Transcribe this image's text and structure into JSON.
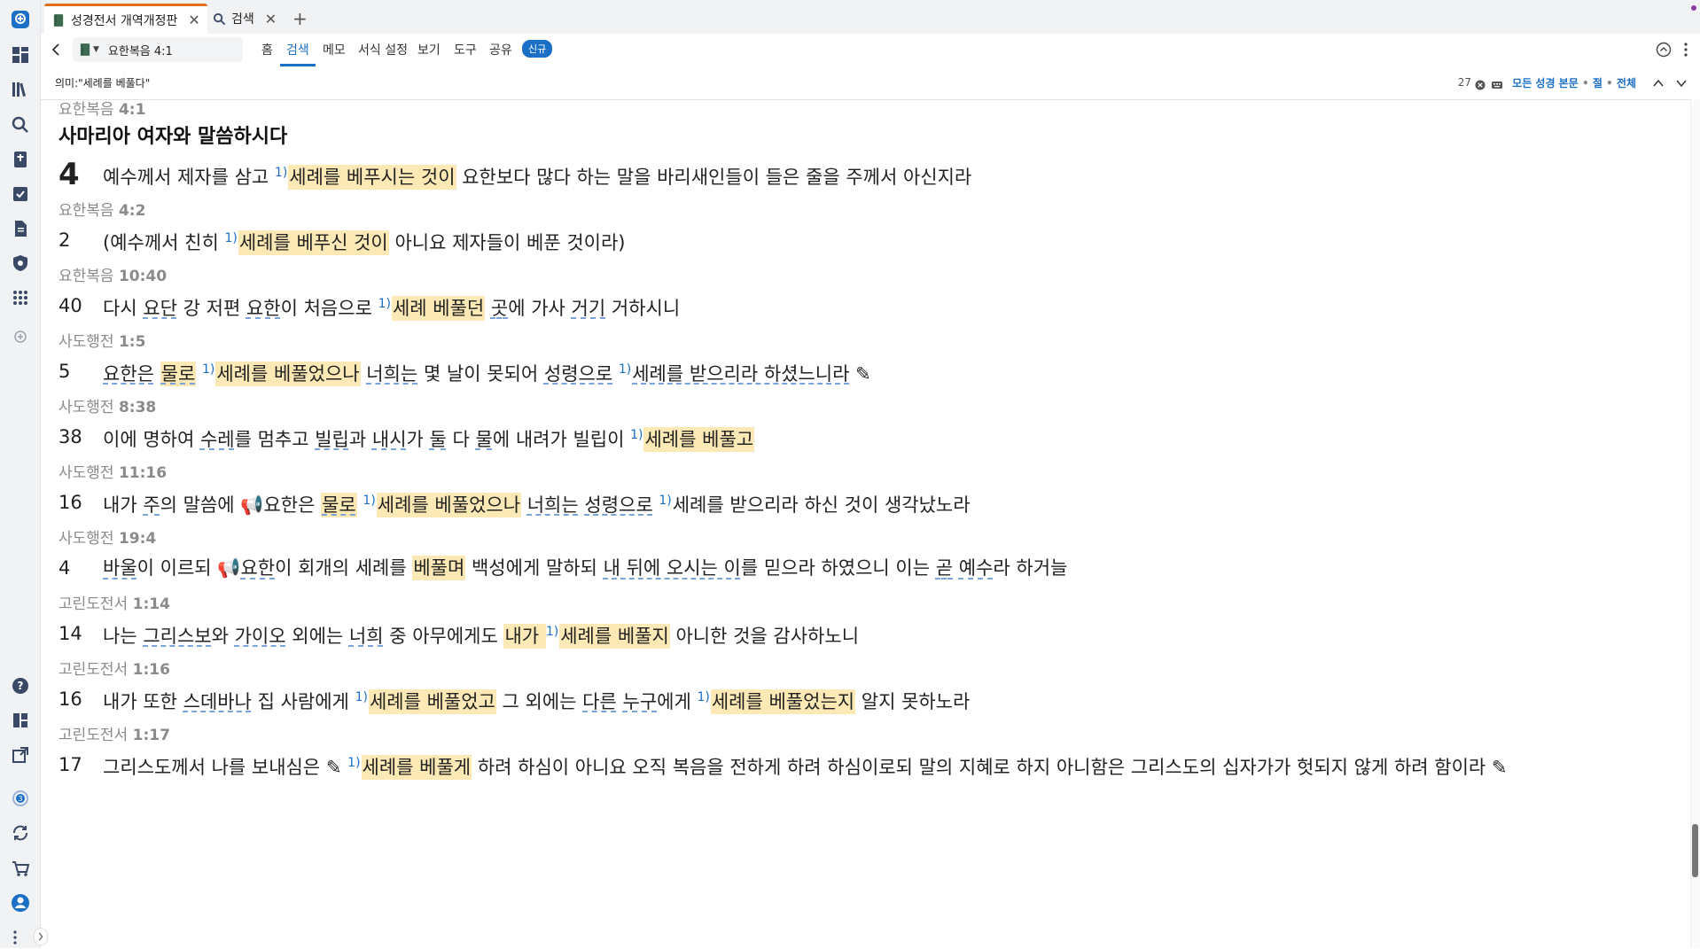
{
  "tabs": [
    {
      "label": "성경전서 개역개정판",
      "active": true
    },
    {
      "label": "검색",
      "active": false
    }
  ],
  "toolbar": {
    "reference": "요한복음 4:1",
    "menu": [
      "홈",
      "검색",
      "메모",
      "서식 설정",
      "보기",
      "도구",
      "공유"
    ],
    "active_menu": "검색",
    "new_badge": "신규"
  },
  "search": {
    "query": "의미:\"세례를 베풀다\"",
    "count": "27",
    "scope_label": "모든 성경 본문",
    "scope_sep": "•",
    "scope_unit": "절",
    "scope_all": "전체"
  },
  "colors": {
    "accent": "#1b6fc7",
    "highlight": "#fde9b5",
    "tab_active": "#e06f1f"
  },
  "results": [
    {
      "book": "요한복음",
      "ch": "4:1",
      "heading": "사마리아 여자와 말씀하시다",
      "num": "4",
      "big": true,
      "parts": [
        {
          "t": "예수께서 제자를 삼고 "
        },
        {
          "fn": "1)"
        },
        {
          "t": "세례를 베푸시는 것이",
          "h": true
        },
        {
          "t": " 요한보다 많다 하는 말을 바리새인들이 들은 줄을 주께서 아신지라"
        }
      ]
    },
    {
      "book": "요한복음",
      "ch": "4:2",
      "num": "2",
      "parts": [
        {
          "t": "(예수께서 친히 "
        },
        {
          "fn": "1)"
        },
        {
          "t": "세례를 베푸신 것이",
          "h": true
        },
        {
          "t": " 아니요 제자들이 베푼 것이라)"
        }
      ]
    },
    {
      "book": "요한복음",
      "ch": "10:40",
      "num": "40",
      "parts": [
        {
          "t": "다시 "
        },
        {
          "t": "요단",
          "u": true
        },
        {
          "t": " 강 저편 "
        },
        {
          "t": "요한",
          "u": true
        },
        {
          "t": "이 처음으로 "
        },
        {
          "fn": "1)"
        },
        {
          "t": "세례 베풀던",
          "h": true
        },
        {
          "t": " "
        },
        {
          "t": "곳",
          "u": true
        },
        {
          "t": "에 가사 "
        },
        {
          "t": "거기",
          "u": true
        },
        {
          "t": " 거하시니"
        }
      ]
    },
    {
      "book": "사도행전",
      "ch": "1:5",
      "num": "5",
      "parts": [
        {
          "t": "요한은",
          "u": true
        },
        {
          "t": " "
        },
        {
          "t": "물로",
          "h": true,
          "u": true
        },
        {
          "t": " "
        },
        {
          "fn": "1)"
        },
        {
          "t": "세례를 베풀었으나",
          "h": true
        },
        {
          "t": " "
        },
        {
          "t": "너희는",
          "u": true
        },
        {
          "t": " 몇 날이 못되어 "
        },
        {
          "t": "성령으로",
          "u": true
        },
        {
          "t": " "
        },
        {
          "fn": "1)"
        },
        {
          "t": "세례를 받으리라 하셨느니라",
          "u": true
        },
        {
          "t": " ✎"
        }
      ]
    },
    {
      "book": "사도행전",
      "ch": "8:38",
      "num": "38",
      "parts": [
        {
          "t": "이에 명하여 "
        },
        {
          "t": "수레",
          "u": true
        },
        {
          "t": "를 멈추고 "
        },
        {
          "t": "빌립",
          "u": true
        },
        {
          "t": "과 "
        },
        {
          "t": "내시",
          "u": true
        },
        {
          "t": "가 "
        },
        {
          "t": "둘",
          "u": true
        },
        {
          "t": " 다 "
        },
        {
          "t": "물",
          "u": true
        },
        {
          "t": "에 내려가 빌립이 "
        },
        {
          "fn": "1)"
        },
        {
          "t": "세례를 베풀고",
          "h": true
        }
      ]
    },
    {
      "book": "사도행전",
      "ch": "11:16",
      "num": "16",
      "parts": [
        {
          "t": "내가 "
        },
        {
          "t": "주",
          "u": true
        },
        {
          "t": "의 말씀에 "
        },
        {
          "t": "📢"
        },
        {
          "t": "요한은 "
        },
        {
          "t": "물로",
          "h": true,
          "u": true
        },
        {
          "t": " "
        },
        {
          "fn": "1)"
        },
        {
          "t": "세례를 베풀었으나",
          "h": true
        },
        {
          "t": " "
        },
        {
          "t": "너희는",
          "u": true
        },
        {
          "t": " "
        },
        {
          "t": "성령으로",
          "u": true
        },
        {
          "t": " "
        },
        {
          "fn": "1)"
        },
        {
          "t": "세례를 받으리라 하신 것이 생각났노라"
        }
      ]
    },
    {
      "book": "사도행전",
      "ch": "19:4",
      "num": "4",
      "parts": [
        {
          "t": "바울",
          "u": true
        },
        {
          "t": "이 이르되 "
        },
        {
          "t": "📢"
        },
        {
          "t": "요한",
          "u": true
        },
        {
          "t": "이 회개의 세례를 "
        },
        {
          "t": "베풀며",
          "h": true
        },
        {
          "t": " 백성에게 말하되 "
        },
        {
          "t": "내 뒤에 오시는 이",
          "u": true
        },
        {
          "t": "를 믿으라 하였으니 이는 "
        },
        {
          "t": "곧",
          "u": true
        },
        {
          "t": " "
        },
        {
          "t": "예수",
          "u": true
        },
        {
          "t": "라 하거늘"
        }
      ]
    },
    {
      "book": "고린도전서",
      "ch": "1:14",
      "num": "14",
      "parts": [
        {
          "t": "나는 "
        },
        {
          "t": "그리스보",
          "u": true
        },
        {
          "t": "와 "
        },
        {
          "t": "가이오",
          "u": true
        },
        {
          "t": " 외에는 "
        },
        {
          "t": "너희",
          "u": true
        },
        {
          "t": " 중 아무에게도 "
        },
        {
          "t": "내가 ",
          "h": true
        },
        {
          "fn": "1)"
        },
        {
          "t": "세례를 베풀지",
          "h": true
        },
        {
          "t": " 아니한 것을 감사하노니"
        }
      ]
    },
    {
      "book": "고린도전서",
      "ch": "1:16",
      "num": "16",
      "parts": [
        {
          "t": "내가 또한 "
        },
        {
          "t": "스데바나",
          "u": true
        },
        {
          "t": " 집 사람에게 "
        },
        {
          "fn": "1)"
        },
        {
          "t": "세례를 베풀었고",
          "h": true
        },
        {
          "t": " 그 외에는 "
        },
        {
          "t": "다른",
          "u": true
        },
        {
          "t": " "
        },
        {
          "t": "누구",
          "u": true
        },
        {
          "t": "에게 "
        },
        {
          "fn": "1)"
        },
        {
          "t": "세례를 베풀었는지",
          "h": true
        },
        {
          "t": " 알지 못하노라"
        }
      ]
    },
    {
      "book": "고린도전서",
      "ch": "1:17",
      "num": "17",
      "parts": [
        {
          "t": "그리스도께서 나를 보내심은 "
        },
        {
          "t": "✎ "
        },
        {
          "fn": "1)"
        },
        {
          "t": "세례를 베풀게",
          "h": true
        },
        {
          "t": " 하려 하심이 아니요 오직 복음을 전하게 하려 하심이로되 말의 지혜로 하지 아니함은 그리스도의 십자가가 헛되지 않게 하려 함이라 ✎"
        }
      ]
    }
  ]
}
